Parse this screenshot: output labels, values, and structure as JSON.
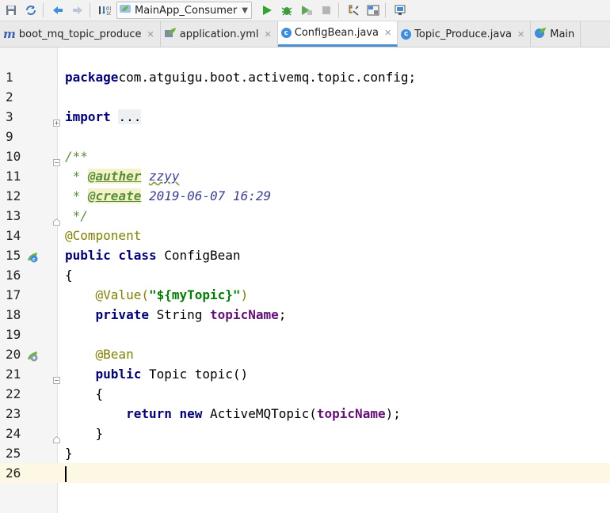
{
  "toolbar": {
    "icons": [
      "save-icon",
      "sync-icon",
      "back-arrow-icon",
      "forward-arrow-icon",
      "build-icon"
    ],
    "run_config": {
      "label": "MainApp_Consumer",
      "icon": "spring-boot-icon"
    },
    "actions": [
      "run-icon",
      "debug-icon",
      "coverage-icon",
      "stop-icon",
      "project-structure-icon",
      "layout-icon",
      "git-icon"
    ]
  },
  "tabs": [
    {
      "label": "boot_mq_topic_produce",
      "icon": "maven-m-icon",
      "active": false
    },
    {
      "label": "application.yml",
      "icon": "spring-leaf-icon",
      "active": false
    },
    {
      "label": "ConfigBean.java",
      "icon": "class-c-icon",
      "active": true
    },
    {
      "label": "Topic_Produce.java",
      "icon": "class-c-icon",
      "active": false
    },
    {
      "label": "Main",
      "icon": "spring-class-icon",
      "active": false
    }
  ],
  "editor": {
    "current_line": "26",
    "lines": [
      {
        "n": "1",
        "t": [
          [
            "kw",
            "package"
          ],
          [
            "",
            "com.atguigu.boot.activemq.topic.config;"
          ]
        ]
      },
      {
        "n": "2",
        "t": []
      },
      {
        "n": "3",
        "t": [
          [
            "kw",
            "import"
          ],
          [
            "",
            " "
          ],
          [
            "folded",
            "..."
          ]
        ]
      },
      {
        "n": "9",
        "t": []
      },
      {
        "n": "10",
        "t": [
          [
            "doc",
            "/**"
          ]
        ]
      },
      {
        "n": "11",
        "t": [
          [
            "doc",
            " * "
          ],
          [
            "doctag",
            "@auther"
          ],
          [
            "doc",
            " "
          ],
          [
            "docname",
            "zzyy"
          ]
        ]
      },
      {
        "n": "12",
        "t": [
          [
            "doc",
            " * "
          ],
          [
            "doctag",
            "@create"
          ],
          [
            "doc",
            " "
          ],
          [
            "docval",
            "2019-06-07 16:29"
          ]
        ]
      },
      {
        "n": "13",
        "t": [
          [
            "doc",
            " */"
          ]
        ]
      },
      {
        "n": "14",
        "t": [
          [
            "ann",
            "@Component"
          ]
        ]
      },
      {
        "n": "15",
        "t": [
          [
            "kw",
            "public class"
          ],
          [
            "",
            " ConfigBean"
          ]
        ]
      },
      {
        "n": "16",
        "t": [
          [
            "",
            "{"
          ]
        ]
      },
      {
        "n": "17",
        "t": [
          [
            "",
            "    "
          ],
          [
            "ann",
            "@Value("
          ],
          [
            "str",
            "\"${myTopic}\""
          ],
          [
            "ann",
            ")"
          ]
        ]
      },
      {
        "n": "18",
        "t": [
          [
            "",
            "    "
          ],
          [
            "kw",
            "private"
          ],
          [
            "",
            " String "
          ],
          [
            "field",
            "topicName"
          ],
          [
            "",
            ";"
          ]
        ]
      },
      {
        "n": "19",
        "t": []
      },
      {
        "n": "20",
        "t": [
          [
            "",
            "    "
          ],
          [
            "ann",
            "@Bean"
          ]
        ]
      },
      {
        "n": "21",
        "t": [
          [
            "",
            "    "
          ],
          [
            "kw",
            "public"
          ],
          [
            "",
            " Topic topic()"
          ]
        ]
      },
      {
        "n": "22",
        "t": [
          [
            "",
            "    {"
          ]
        ]
      },
      {
        "n": "23",
        "t": [
          [
            "",
            "        "
          ],
          [
            "kw",
            "return new"
          ],
          [
            "",
            " ActiveMQTopic("
          ],
          [
            "field",
            "topicName"
          ],
          [
            "",
            ");"
          ]
        ]
      },
      {
        "n": "24",
        "t": [
          [
            "",
            "    }"
          ]
        ]
      },
      {
        "n": "25",
        "t": [
          [
            "",
            "}"
          ]
        ]
      },
      {
        "n": "26",
        "t": []
      }
    ],
    "gutter_icons": {
      "15": "spring-bean-class-icon",
      "20": "spring-bean-method-icon"
    },
    "fold_markers": {
      "3": "plus",
      "10": "minus",
      "13": "end",
      "21": "minus",
      "24": "end"
    }
  }
}
